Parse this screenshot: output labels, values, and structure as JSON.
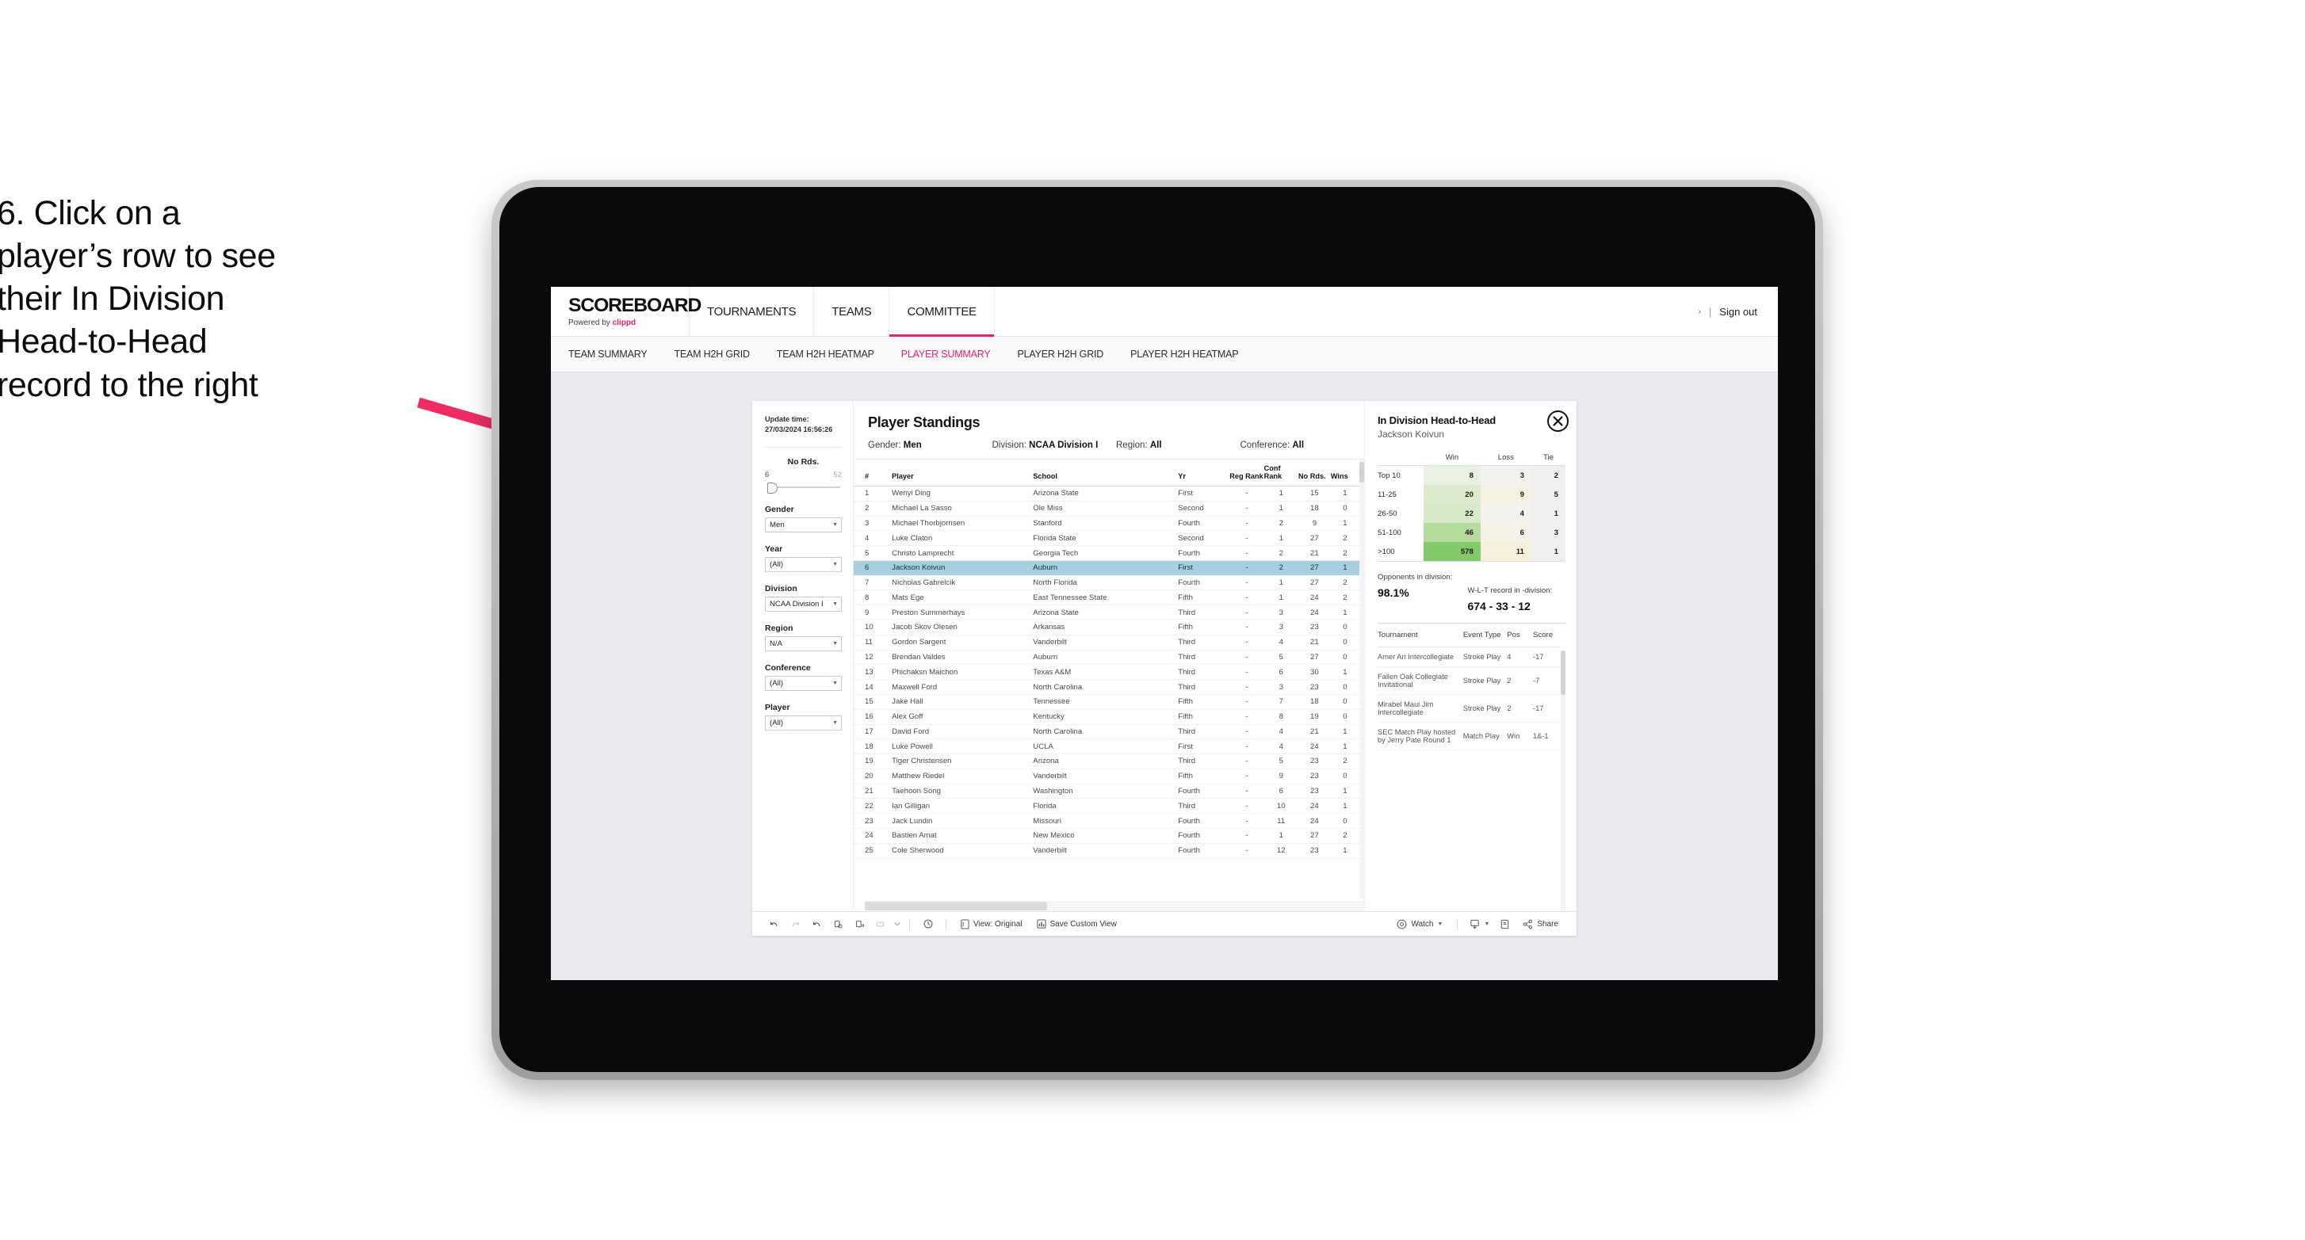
{
  "annotation": {
    "lines": [
      "6. Click on a",
      "player’s row to see",
      "their In Division",
      "Head-to-Head",
      "record to the right"
    ],
    "arrow_color": "#ef2d64"
  },
  "header": {
    "brand_title": "SCOREBOARD",
    "brand_sub_prefix": "Powered by ",
    "brand_sub_name": "clippd",
    "nav": [
      {
        "label": "TOURNAMENTS",
        "active": false
      },
      {
        "label": "TEAMS",
        "active": false
      },
      {
        "label": "COMMITTEE",
        "active": true
      }
    ],
    "user_caret": "›",
    "separator": "|",
    "signout_label": "Sign out",
    "accent_color": "#e5245f"
  },
  "subnav": [
    {
      "label": "TEAM SUMMARY",
      "active": false
    },
    {
      "label": "TEAM H2H GRID",
      "active": false
    },
    {
      "label": "TEAM H2H HEATMAP",
      "active": false
    },
    {
      "label": "PLAYER SUMMARY",
      "active": true
    },
    {
      "label": "PLAYER H2H GRID",
      "active": false
    },
    {
      "label": "PLAYER H2H HEATMAP",
      "active": false
    }
  ],
  "rail": {
    "update_label": "Update time:",
    "update_value": "27/03/2024 16:56:26",
    "slider": {
      "title": "No Rds.",
      "min": "6",
      "max": "52"
    },
    "filters": [
      {
        "label": "Gender",
        "value": "Men"
      },
      {
        "label": "Year",
        "value": "(All)"
      },
      {
        "label": "Division",
        "value": "NCAA Division I"
      },
      {
        "label": "Region",
        "value": "N/A"
      },
      {
        "label": "Conference",
        "value": "(All)"
      },
      {
        "label": "Player",
        "value": "(All)"
      }
    ]
  },
  "standings": {
    "title": "Player Standings",
    "meta": [
      {
        "label": "Gender:",
        "value": "Men"
      },
      {
        "label": "Division:",
        "value": "NCAA Division I"
      },
      {
        "label": "Region:",
        "value": "All"
      },
      {
        "label": "Conference:",
        "value": "All"
      }
    ],
    "columns": [
      "#",
      "Player",
      "School",
      "Yr",
      "Reg Rank",
      "Conf Rank",
      "No Rds.",
      "Wins"
    ],
    "rows": [
      {
        "n": "1",
        "player": "Wenyi Ding",
        "school": "Arizona State",
        "yr": "First",
        "reg": "-",
        "conf": "1",
        "rds": "15",
        "wins": "1",
        "selected": false
      },
      {
        "n": "2",
        "player": "Michael La Sasso",
        "school": "Ole Miss",
        "yr": "Second",
        "reg": "-",
        "conf": "1",
        "rds": "18",
        "wins": "0",
        "selected": false
      },
      {
        "n": "3",
        "player": "Michael Thorbjornsen",
        "school": "Stanford",
        "yr": "Fourth",
        "reg": "-",
        "conf": "2",
        "rds": "9",
        "wins": "1",
        "selected": false
      },
      {
        "n": "4",
        "player": "Luke Claton",
        "school": "Florida State",
        "yr": "Second",
        "reg": "-",
        "conf": "1",
        "rds": "27",
        "wins": "2",
        "selected": false
      },
      {
        "n": "5",
        "player": "Christo Lamprecht",
        "school": "Georgia Tech",
        "yr": "Fourth",
        "reg": "-",
        "conf": "2",
        "rds": "21",
        "wins": "2",
        "selected": false
      },
      {
        "n": "6",
        "player": "Jackson Koivun",
        "school": "Auburn",
        "yr": "First",
        "reg": "-",
        "conf": "2",
        "rds": "27",
        "wins": "1",
        "selected": true
      },
      {
        "n": "7",
        "player": "Nicholas Gabrelcik",
        "school": "North Florida",
        "yr": "Fourth",
        "reg": "-",
        "conf": "1",
        "rds": "27",
        "wins": "2",
        "selected": false
      },
      {
        "n": "8",
        "player": "Mats Ege",
        "school": "East Tennessee State",
        "yr": "Fifth",
        "reg": "-",
        "conf": "1",
        "rds": "24",
        "wins": "2",
        "selected": false
      },
      {
        "n": "9",
        "player": "Preston Summerhays",
        "school": "Arizona State",
        "yr": "Third",
        "reg": "-",
        "conf": "3",
        "rds": "24",
        "wins": "1",
        "selected": false
      },
      {
        "n": "10",
        "player": "Jacob Skov Olesen",
        "school": "Arkansas",
        "yr": "Fifth",
        "reg": "-",
        "conf": "3",
        "rds": "23",
        "wins": "0",
        "selected": false
      },
      {
        "n": "11",
        "player": "Gordon Sargent",
        "school": "Vanderbilt",
        "yr": "Third",
        "reg": "-",
        "conf": "4",
        "rds": "21",
        "wins": "0",
        "selected": false
      },
      {
        "n": "12",
        "player": "Brendan Valdes",
        "school": "Auburn",
        "yr": "Third",
        "reg": "-",
        "conf": "5",
        "rds": "27",
        "wins": "0",
        "selected": false
      },
      {
        "n": "13",
        "player": "Phichaksn Maichon",
        "school": "Texas A&M",
        "yr": "Third",
        "reg": "-",
        "conf": "6",
        "rds": "30",
        "wins": "1",
        "selected": false
      },
      {
        "n": "14",
        "player": "Maxwell Ford",
        "school": "North Carolina",
        "yr": "Third",
        "reg": "-",
        "conf": "3",
        "rds": "23",
        "wins": "0",
        "selected": false
      },
      {
        "n": "15",
        "player": "Jake Hall",
        "school": "Tennessee",
        "yr": "Fifth",
        "reg": "-",
        "conf": "7",
        "rds": "18",
        "wins": "0",
        "selected": false
      },
      {
        "n": "16",
        "player": "Alex Goff",
        "school": "Kentucky",
        "yr": "Fifth",
        "reg": "-",
        "conf": "8",
        "rds": "19",
        "wins": "0",
        "selected": false
      },
      {
        "n": "17",
        "player": "David Ford",
        "school": "North Carolina",
        "yr": "Third",
        "reg": "-",
        "conf": "4",
        "rds": "21",
        "wins": "1",
        "selected": false
      },
      {
        "n": "18",
        "player": "Luke Powell",
        "school": "UCLA",
        "yr": "First",
        "reg": "-",
        "conf": "4",
        "rds": "24",
        "wins": "1",
        "selected": false
      },
      {
        "n": "19",
        "player": "Tiger Christensen",
        "school": "Arizona",
        "yr": "Third",
        "reg": "-",
        "conf": "5",
        "rds": "23",
        "wins": "2",
        "selected": false
      },
      {
        "n": "20",
        "player": "Matthew Riedel",
        "school": "Vanderbilt",
        "yr": "Fifth",
        "reg": "-",
        "conf": "9",
        "rds": "23",
        "wins": "0",
        "selected": false
      },
      {
        "n": "21",
        "player": "Taehoon Song",
        "school": "Washington",
        "yr": "Fourth",
        "reg": "-",
        "conf": "6",
        "rds": "23",
        "wins": "1",
        "selected": false
      },
      {
        "n": "22",
        "player": "Ian Gilligan",
        "school": "Florida",
        "yr": "Third",
        "reg": "-",
        "conf": "10",
        "rds": "24",
        "wins": "1",
        "selected": false
      },
      {
        "n": "23",
        "player": "Jack Lundin",
        "school": "Missouri",
        "yr": "Fourth",
        "reg": "-",
        "conf": "11",
        "rds": "24",
        "wins": "0",
        "selected": false
      },
      {
        "n": "24",
        "player": "Bastien Amat",
        "school": "New Mexico",
        "yr": "Fourth",
        "reg": "-",
        "conf": "1",
        "rds": "27",
        "wins": "2",
        "selected": false
      },
      {
        "n": "25",
        "player": "Cole Sherwood",
        "school": "Vanderbilt",
        "yr": "Fourth",
        "reg": "-",
        "conf": "12",
        "rds": "23",
        "wins": "1",
        "selected": false
      }
    ]
  },
  "detail": {
    "title": "In Division Head-to-Head",
    "player": "Jackson Koivun",
    "close_icon": "close-icon",
    "h2h_columns": [
      "",
      "Win",
      "Loss",
      "Tie"
    ],
    "h2h_rows": [
      {
        "bucket": "Top 10",
        "win": "8",
        "loss": "3",
        "tie": "2",
        "win_color": "#e9f2e2",
        "loss_color": "#f2f2ef",
        "tie_color": "#efefef"
      },
      {
        "bucket": "11-25",
        "win": "20",
        "loss": "9",
        "tie": "5",
        "win_color": "#dcebd0",
        "loss_color": "#f5f2e3",
        "tie_color": "#efefef"
      },
      {
        "bucket": "26-50",
        "win": "22",
        "loss": "4",
        "tie": "1",
        "win_color": "#d8e9ca",
        "loss_color": "#f3f2ec",
        "tie_color": "#efefef"
      },
      {
        "bucket": "51-100",
        "win": "46",
        "loss": "6",
        "tie": "3",
        "win_color": "#b5dc9c",
        "loss_color": "#f5f2e6",
        "tie_color": "#efefef"
      },
      {
        "bucket": ">100",
        "win": "578",
        "loss": "11",
        "tie": "1",
        "win_color": "#84ca6a",
        "loss_color": "#f5f0dc",
        "tie_color": "#efefef"
      }
    ],
    "summary": [
      {
        "label": "Opponents in division:",
        "value": "98.1%"
      },
      {
        "label": "W-L-T record in -division:",
        "value": "674 - 33 - 12"
      }
    ],
    "tournament_columns": [
      "Tournament",
      "Event Type",
      "Pos",
      "Score"
    ],
    "tournaments": [
      {
        "name": "Amer Ari Intercollegiate",
        "type": "Stroke Play",
        "pos": "4",
        "score": "-17"
      },
      {
        "name": "Fallen Oak Collegiate Invitational",
        "type": "Stroke Play",
        "pos": "2",
        "score": "-7"
      },
      {
        "name": "Mirabel Maui Jim Intercollegiate",
        "type": "Stroke Play",
        "pos": "2",
        "score": "-17"
      },
      {
        "name": "SEC Match Play hosted by Jerry Pate Round 1",
        "type": "Match Play",
        "pos": "Win",
        "score": "1&-1"
      }
    ]
  },
  "toolbar": {
    "view_label": "View: Original",
    "save_label": "Save Custom View",
    "watch_label": "Watch",
    "share_label": "Share"
  }
}
